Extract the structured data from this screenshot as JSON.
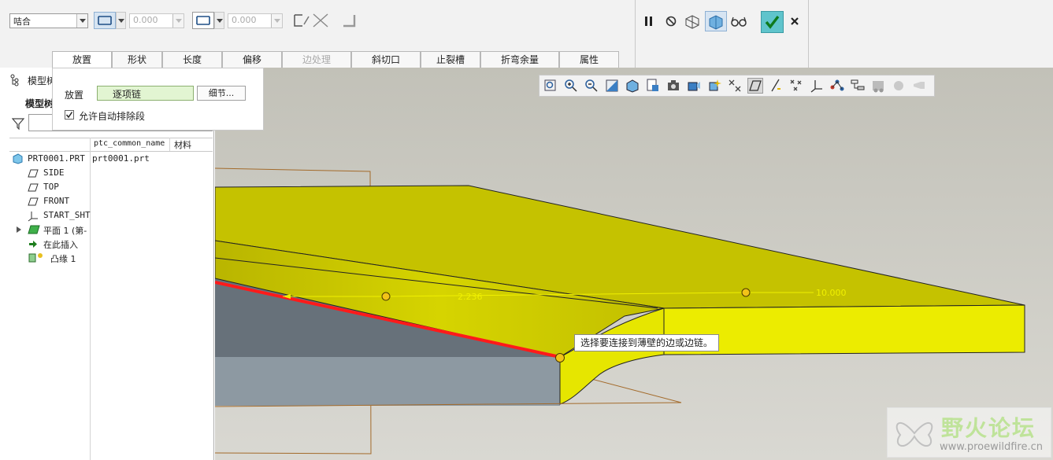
{
  "dashboard": {
    "type_select": "咭合",
    "offset_1": "0.000",
    "offset_2": "0.000",
    "right_tools": [
      "pause-icon",
      "no-preview-icon",
      "wireframe-preview-icon",
      "verify-mode-icon",
      "glasses-preview-icon",
      "ok-check-icon",
      "cancel-x-icon"
    ]
  },
  "tabs": [
    {
      "label": "放置",
      "state": "active"
    },
    {
      "label": "形状",
      "state": "normal"
    },
    {
      "label": "长度",
      "state": "normal"
    },
    {
      "label": "偏移",
      "state": "normal"
    },
    {
      "label": "边处理",
      "state": "disabled"
    },
    {
      "label": "斜切口",
      "state": "normal"
    },
    {
      "label": "止裂槽",
      "state": "normal"
    },
    {
      "label": "折弯余量",
      "state": "normal"
    },
    {
      "label": "属性",
      "state": "normal"
    }
  ],
  "placement_panel": {
    "label": "放置",
    "collector_value": "逐项链",
    "details_button": "细节...",
    "auto_exclude_label": "允许自动排除段",
    "auto_exclude_checked": true
  },
  "model_tree": {
    "header_title": "模型树",
    "header_title_bold": "模型树",
    "columns": [
      "ptc_common_name",
      "材料"
    ],
    "items": [
      {
        "label": "PRT0001.PRT",
        "common_name": "prt0001.prt",
        "icon": "part-icon"
      },
      {
        "label": "SIDE",
        "common_name": "",
        "icon": "datum-plane-icon"
      },
      {
        "label": "TOP",
        "common_name": "",
        "icon": "datum-plane-icon"
      },
      {
        "label": "FRONT",
        "common_name": "",
        "icon": "datum-plane-icon"
      },
      {
        "label": "START_SHT",
        "common_name": "",
        "icon": "coordinate-system-icon"
      },
      {
        "label": "平面 1 (第-",
        "common_name": "",
        "icon": "planar-wall-icon"
      },
      {
        "label": "在此插入",
        "common_name": "",
        "icon": "insert-here-arrow-icon"
      },
      {
        "label": "凸缘 1",
        "common_name": "",
        "icon": "flange-icon"
      }
    ]
  },
  "graphics": {
    "dim_1": "2.236",
    "dim_2": "10.000",
    "tooltip": "选择要连接到薄壁的边或边链。",
    "watermark_title": "野火论坛",
    "watermark_url": "www.proewildfire.cn",
    "colors": {
      "surface_yellow": "#c5c200",
      "front_yellow": "#ecec00",
      "selected_edge": "#ff1a1a",
      "background": "#cfcdc6"
    }
  }
}
